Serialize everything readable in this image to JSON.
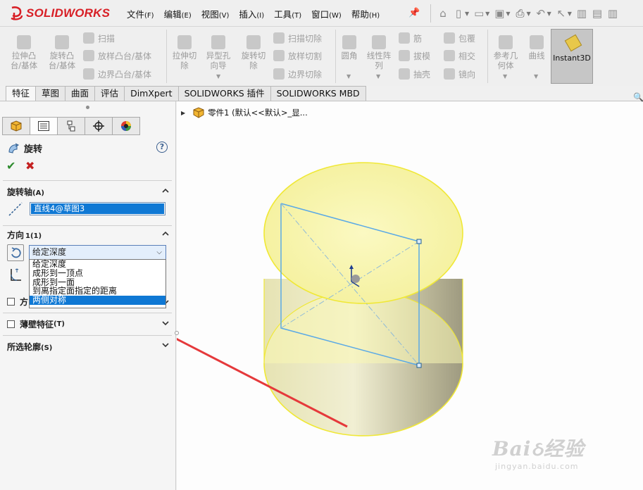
{
  "app": {
    "logo_text": "SOLIDWORKS"
  },
  "menu": [
    {
      "label": "文件",
      "acc": "(F)"
    },
    {
      "label": "编辑",
      "acc": "(E)"
    },
    {
      "label": "视图",
      "acc": "(V)"
    },
    {
      "label": "插入",
      "acc": "(I)"
    },
    {
      "label": "工具",
      "acc": "(T)"
    },
    {
      "label": "窗口",
      "acc": "(W)"
    },
    {
      "label": "帮助",
      "acc": "(H)"
    }
  ],
  "ribbon": {
    "extrude_boss": "拉伸凸\n台/基体",
    "revolve_boss": "旋转凸\n台/基体",
    "sweep": "扫描",
    "loft_boss": "放样凸台/基体",
    "boundary_boss": "边界凸台/基体",
    "extrude_cut": "拉伸切\n除",
    "hole_wizard": "异型孔\n向导",
    "revolve_cut": "旋转切\n除",
    "swept_cut": "扫描切除",
    "lofted_cut": "放样切割",
    "boundary_cut": "边界切除",
    "fillet": "圆角",
    "linear_pattern": "线性阵\n列",
    "rib": "筋",
    "draft": "拔模",
    "shell": "抽壳",
    "wrap": "包覆",
    "intersect": "相交",
    "mirror": "镜向",
    "ref_geometry": "参考几\n何体",
    "curves": "曲线",
    "instant3d": "Instant3D"
  },
  "tabs": [
    "特征",
    "草图",
    "曲面",
    "评估",
    "DimXpert",
    "SOLIDWORKS 插件",
    "SOLIDWORKS MBD"
  ],
  "pm": {
    "title": "旋转",
    "axis_section": "旋转轴",
    "axis_section_acc": "(A)",
    "axis_value": "直线4@草图3",
    "direction_section": "方向",
    "direction_section_acc": "1(1)",
    "end_condition": "给定深度",
    "dropdown_options": [
      "给定深度",
      "成形到一顶点",
      "成形到一面",
      "到离指定面指定的距离",
      "两侧对称"
    ],
    "selected_option": "两侧对称",
    "direction2_label": "方",
    "thin_feature": "薄壁特征",
    "thin_feature_acc": "(T)",
    "selected_contours": "所选轮廓",
    "selected_contours_acc": "(S)"
  },
  "tree": {
    "root_label": "零件1  (默认<<默认>_显..."
  },
  "watermark": {
    "big": "Baiઠ经验",
    "small": "jingyan.baidu.com"
  },
  "colors": {
    "brand_red": "#d81f26",
    "selection_blue": "#0f78d4",
    "face_yellow": "#f8f5a8",
    "cylinder_edge": "#f0e836",
    "sketch_blue": "#5aa9e6",
    "arrow_red": "#e5393b"
  }
}
